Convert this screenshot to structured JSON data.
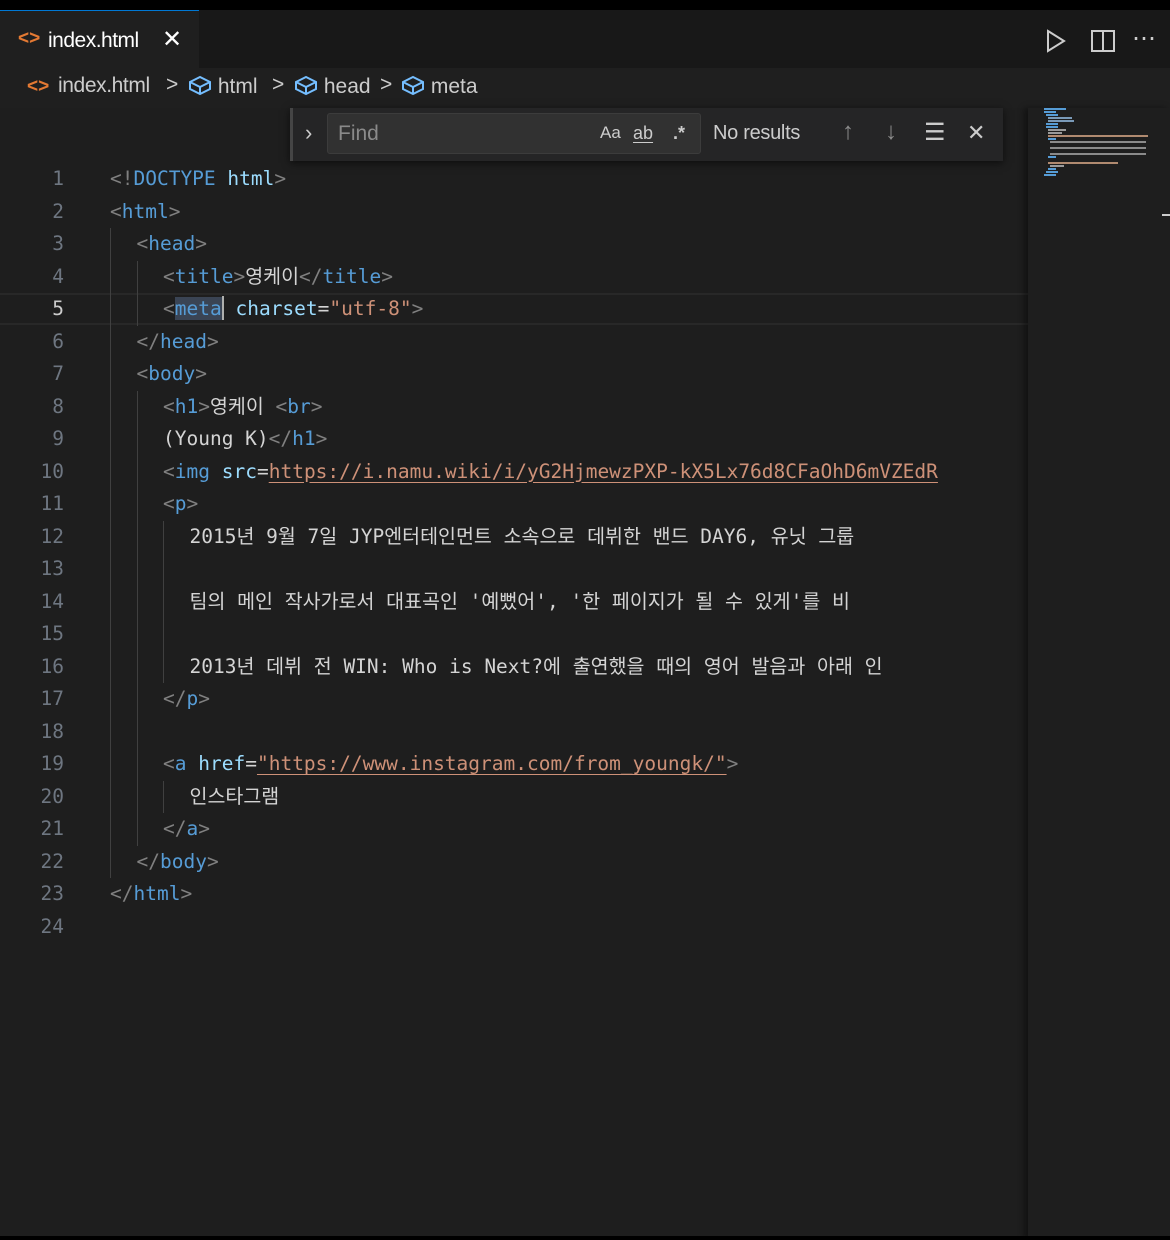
{
  "tab": {
    "icon": "<>",
    "label": "index.html",
    "close": "✕"
  },
  "actions": {
    "run": "run-icon",
    "split": "split-editor-icon",
    "more": "⋯"
  },
  "breadcrumb": {
    "file_icon": "<>",
    "file": "index.html",
    "items": [
      "html",
      "head",
      "meta"
    ],
    "separator": ">"
  },
  "find": {
    "placeholder": "Find",
    "value": "",
    "match_case": "Aa",
    "whole_word": "ab",
    "regex": ".*",
    "results": "No results"
  },
  "editor": {
    "active_line": 5,
    "line_numbers": [
      "1",
      "2",
      "3",
      "4",
      "5",
      "6",
      "7",
      "8",
      "9",
      "10",
      "11",
      "12",
      "13",
      "14",
      "15",
      "16",
      "17",
      "18",
      "19",
      "20",
      "21",
      "22",
      "23",
      "24"
    ],
    "lines": [
      [
        [
          "t-b",
          "<!"
        ],
        [
          "t-tag",
          "DOCTYPE"
        ],
        [
          "t-txt",
          " "
        ],
        [
          "t-attr",
          "html"
        ],
        [
          "t-b",
          ">"
        ]
      ],
      [
        [
          "t-b",
          "<"
        ],
        [
          "t-tag",
          "html"
        ],
        [
          "t-b",
          ">"
        ]
      ],
      [
        [
          "t-b",
          "<"
        ],
        [
          "t-tag",
          "head"
        ],
        [
          "t-b",
          ">"
        ]
      ],
      [
        [
          "t-b",
          "<"
        ],
        [
          "t-tag",
          "title"
        ],
        [
          "t-b",
          ">"
        ],
        [
          "t-txt",
          "영케이"
        ],
        [
          "t-b",
          "</"
        ],
        [
          "t-tag",
          "title"
        ],
        [
          "t-b",
          ">"
        ]
      ],
      [
        [
          "t-b",
          "<"
        ],
        [
          "t-tag hl",
          "meta"
        ],
        [
          "cursor",
          ""
        ],
        [
          "t-txt",
          " "
        ],
        [
          "t-attr",
          "charset"
        ],
        [
          "t-txt",
          "="
        ],
        [
          "t-str",
          "\"utf-8\""
        ],
        [
          "t-b",
          ">"
        ]
      ],
      [
        [
          "t-b",
          "</"
        ],
        [
          "t-tag",
          "head"
        ],
        [
          "t-b",
          ">"
        ]
      ],
      [
        [
          "t-b",
          "<"
        ],
        [
          "t-tag",
          "body"
        ],
        [
          "t-b",
          ">"
        ]
      ],
      [
        [
          "t-b",
          "<"
        ],
        [
          "t-tag",
          "h1"
        ],
        [
          "t-b",
          ">"
        ],
        [
          "t-txt",
          "영케이 "
        ],
        [
          "t-b",
          "<"
        ],
        [
          "t-tag",
          "br"
        ],
        [
          "t-b",
          ">"
        ]
      ],
      [
        [
          "t-txt",
          "(Young K)"
        ],
        [
          "t-b",
          "</"
        ],
        [
          "t-tag",
          "h1"
        ],
        [
          "t-b",
          ">"
        ]
      ],
      [
        [
          "t-b",
          "<"
        ],
        [
          "t-tag",
          "img"
        ],
        [
          "t-txt",
          " "
        ],
        [
          "t-attr",
          "src"
        ],
        [
          "t-txt",
          "="
        ],
        [
          "t-link",
          "https://i.namu.wiki/i/yG2HjmewzPXP-kX5Lx76d8CFaOhD6mVZEdR"
        ]
      ],
      [
        [
          "t-b",
          "<"
        ],
        [
          "t-tag",
          "p"
        ],
        [
          "t-b",
          ">"
        ]
      ],
      [
        [
          "t-txt",
          "2015년 9월 7일 JYP엔터테인먼트 소속으로 데뷔한 밴드 DAY6, 유닛 그룹"
        ]
      ],
      [],
      [
        [
          "t-txt",
          "팀의 메인 작사가로서 대표곡인 '예뻤어', '한 페이지가 될 수 있게'를 비"
        ]
      ],
      [],
      [
        [
          "t-txt",
          "2013년 데뷔 전 WIN: Who is Next?에 출연했을 때의 영어 발음과 아래 인"
        ]
      ],
      [
        [
          "t-b",
          "</"
        ],
        [
          "t-tag",
          "p"
        ],
        [
          "t-b",
          ">"
        ]
      ],
      [],
      [
        [
          "t-b",
          "<"
        ],
        [
          "t-tag",
          "a"
        ],
        [
          "t-txt",
          " "
        ],
        [
          "t-attr",
          "href"
        ],
        [
          "t-txt",
          "="
        ],
        [
          "t-link",
          "\"https://www.instagram.com/from_youngk/\""
        ],
        [
          "t-b",
          ">"
        ]
      ],
      [
        [
          "t-txt",
          "인스타그램"
        ]
      ],
      [
        [
          "t-b",
          "</"
        ],
        [
          "t-tag",
          "a"
        ],
        [
          "t-b",
          ">"
        ]
      ],
      [
        [
          "t-b",
          "</"
        ],
        [
          "t-tag",
          "body"
        ],
        [
          "t-b",
          ">"
        ]
      ],
      [
        [
          "t-b",
          "</"
        ],
        [
          "t-tag",
          "html"
        ],
        [
          "t-b",
          ">"
        ]
      ],
      []
    ]
  }
}
